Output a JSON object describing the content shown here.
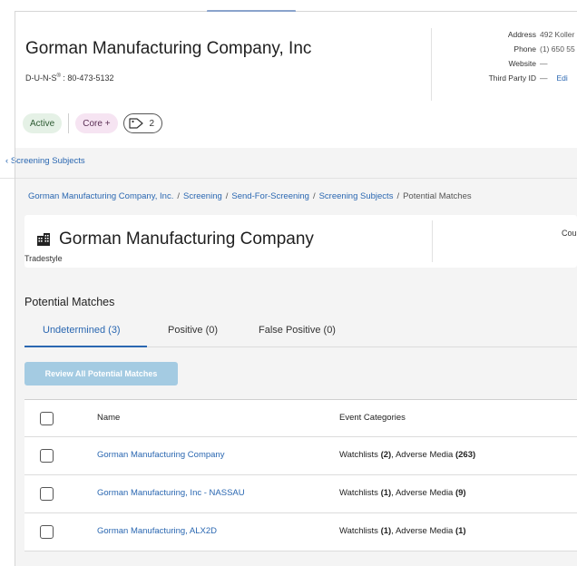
{
  "company": {
    "name": "Gorman Manufacturing Company, Inc",
    "duns_prefix": "D-U-N-S",
    "duns_mark": "®",
    "duns_value": " : 80-473-5132"
  },
  "contact": {
    "address_label": "Address",
    "address_value": "492 Koller",
    "phone_label": "Phone",
    "phone_value": "(1) 650 55",
    "website_label": "Website",
    "website_value": "—",
    "third_party_label": "Third Party ID",
    "third_party_value": "—",
    "edit_label": "Edi"
  },
  "chips": {
    "status": "Active",
    "plan": "Core +",
    "tag_count": "2"
  },
  "nav": {
    "back_label": "Screening Subjects",
    "breadcrumb": [
      "Gorman Manufacturing Company, Inc.",
      "Screening",
      "Send-For-Screening",
      "Screening Subjects",
      "Potential Matches"
    ]
  },
  "subject": {
    "name": "Gorman Manufacturing Company",
    "type": "Tradestyle",
    "right_label": "Cou"
  },
  "matches": {
    "title": "Potential Matches",
    "tabs": [
      {
        "label": "Undetermined (3)"
      },
      {
        "label": "Positive (0)"
      },
      {
        "label": "False Positive (0)"
      }
    ],
    "review_button": "Review All Potential Matches",
    "columns": {
      "name": "Name",
      "categories": "Event Categories"
    },
    "rows": [
      {
        "name": "Gorman Manufacturing Company",
        "watchlists_label": "Watchlists",
        "watchlists_count": "(2)",
        "adverse_label": "Adverse Media",
        "adverse_count": "(263)"
      },
      {
        "name": "Gorman Manufacturing, Inc - NASSAU",
        "watchlists_label": "Watchlists",
        "watchlists_count": "(1)",
        "adverse_label": "Adverse Media",
        "adverse_count": "(9)"
      },
      {
        "name": "Gorman Manufacturing, ALX2D",
        "watchlists_label": "Watchlists",
        "watchlists_count": "(1)",
        "adverse_label": "Adverse Media",
        "adverse_count": "(1)"
      }
    ]
  },
  "colors": {
    "link": "#2a67b1",
    "active_chip_bg": "#e5f1e6",
    "core_chip_bg": "#f6e4f2",
    "review_button_bg": "#a4cbe2"
  }
}
